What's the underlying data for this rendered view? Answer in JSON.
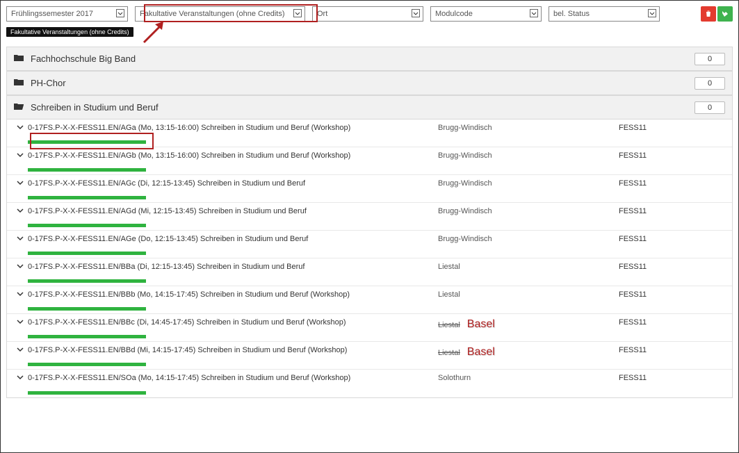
{
  "filters": {
    "semester": "Frühlingssemester 2017",
    "type": "Fakultative Veranstaltungen (ohne Credits)",
    "location": "Ort",
    "modulecode": "Modulcode",
    "status": "bel. Status"
  },
  "tag": "Fakultative Veranstaltungen (ohne Credits)",
  "groups": [
    {
      "id": "g1",
      "title": "Fachhochschule Big Band",
      "open": false,
      "count": 0
    },
    {
      "id": "g2",
      "title": "PH-Chor",
      "open": false,
      "count": 0
    },
    {
      "id": "g3",
      "title": "Schreiben in Studium und Beruf",
      "open": true,
      "count": 0
    }
  ],
  "rows": [
    {
      "desc": "0-17FS.P-X-X-FESS11.EN/AGa (Mo, 13:15-16:00) Schreiben in Studium und Beruf (Workshop)",
      "loc": "Brugg-Windisch",
      "code": "FESS11"
    },
    {
      "desc": "0-17FS.P-X-X-FESS11.EN/AGb (Mo, 13:15-16:00) Schreiben in Studium und Beruf (Workshop)",
      "loc": "Brugg-Windisch",
      "code": "FESS11"
    },
    {
      "desc": "0-17FS.P-X-X-FESS11.EN/AGc (Di, 12:15-13:45) Schreiben in Studium und Beruf",
      "loc": "Brugg-Windisch",
      "code": "FESS11"
    },
    {
      "desc": "0-17FS.P-X-X-FESS11.EN/AGd (Mi, 12:15-13:45) Schreiben in Studium und Beruf",
      "loc": "Brugg-Windisch",
      "code": "FESS11"
    },
    {
      "desc": "0-17FS.P-X-X-FESS11.EN/AGe (Do, 12:15-13:45) Schreiben in Studium und Beruf",
      "loc": "Brugg-Windisch",
      "code": "FESS11"
    },
    {
      "desc": "0-17FS.P-X-X-FESS11.EN/BBa (Di, 12:15-13:45) Schreiben in Studium und Beruf",
      "loc": "Liestal",
      "code": "FESS11"
    },
    {
      "desc": "0-17FS.P-X-X-FESS11.EN/BBb (Mo, 14:15-17:45) Schreiben in Studium und Beruf (Workshop)",
      "loc": "Liestal",
      "code": "FESS11"
    },
    {
      "desc": "0-17FS.P-X-X-FESS11.EN/BBc (Di, 14:45-17:45) Schreiben in Studium und Beruf (Workshop)",
      "loc": "Liestal",
      "override": "Basel",
      "code": "FESS11"
    },
    {
      "desc": "0-17FS.P-X-X-FESS11.EN/BBd (Mi, 14:15-17:45) Schreiben in Studium und Beruf (Workshop)",
      "loc": "Liestal",
      "override": "Basel",
      "code": "FESS11"
    },
    {
      "desc": "0-17FS.P-X-X-FESS11.EN/SOa (Mo, 14:15-17:45) Schreiben in Studium und Beruf (Workshop)",
      "loc": "Solothurn",
      "code": "FESS11"
    }
  ]
}
